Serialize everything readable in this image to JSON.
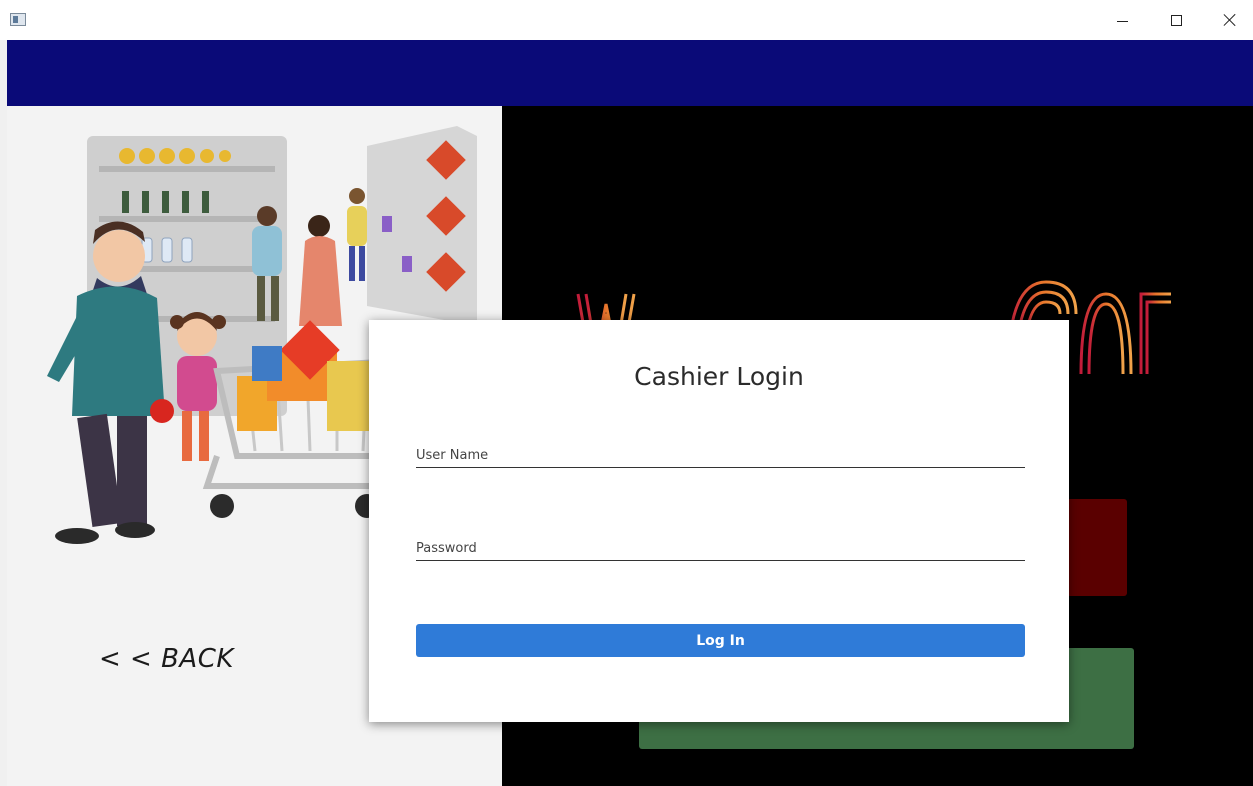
{
  "window": {
    "minimize_icon": "minimize-icon",
    "maximize_icon": "maximize-icon",
    "close_icon": "close-icon"
  },
  "colors": {
    "header_band": "#0a0a78",
    "left_panel": "#f3f3f3",
    "right_panel": "#000000",
    "login_button": "#2f7bd8",
    "red_block": "#5a0000",
    "green_block": "#3d6f44"
  },
  "left_panel": {
    "back_label": "< < BACK"
  },
  "login": {
    "title": "Cashier Login",
    "username_placeholder": "User Name",
    "password_placeholder": "Password",
    "submit_label": "Log In"
  }
}
